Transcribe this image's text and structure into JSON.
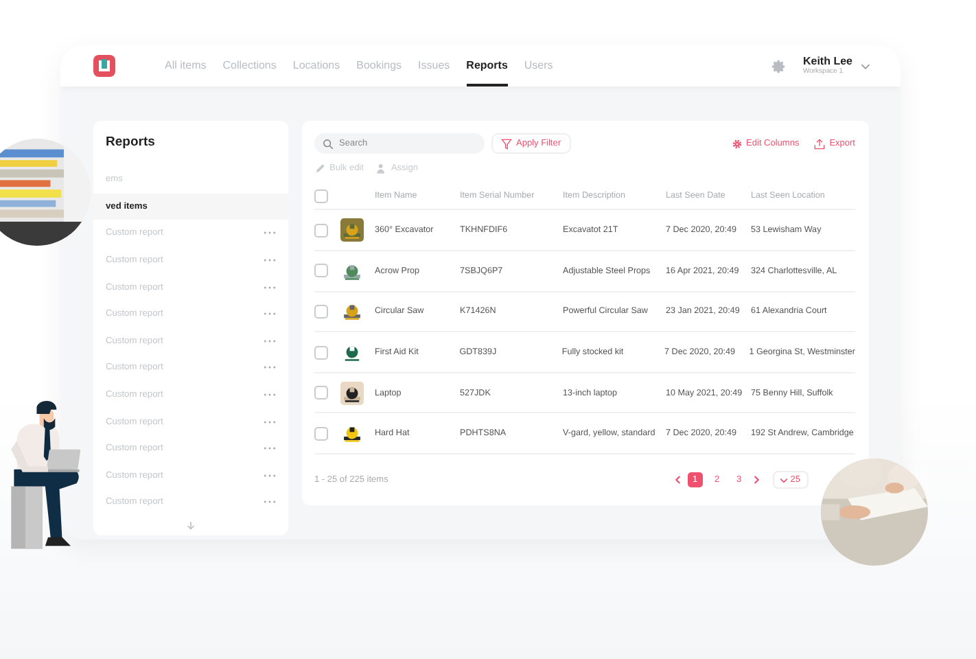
{
  "nav": {
    "tabs": [
      {
        "label": "All items",
        "selected": false
      },
      {
        "label": "Collections",
        "selected": false
      },
      {
        "label": "Locations",
        "selected": false
      },
      {
        "label": "Bookings",
        "selected": false
      },
      {
        "label": "Issues",
        "selected": false
      },
      {
        "label": "Reports",
        "selected": true
      },
      {
        "label": "Users",
        "selected": false
      }
    ],
    "user": {
      "name": "Keith Lee",
      "workspace": "Workspace 1"
    }
  },
  "sidebar": {
    "title": "Reports",
    "items": [
      {
        "label": "ems",
        "selected": false,
        "menu": false
      },
      {
        "label": "ved items",
        "selected": true,
        "menu": false
      },
      {
        "label": "Custom report",
        "selected": false,
        "menu": true
      },
      {
        "label": "Custom report",
        "selected": false,
        "menu": true
      },
      {
        "label": "Custom report",
        "selected": false,
        "menu": true
      },
      {
        "label": "Custom report",
        "selected": false,
        "menu": true
      },
      {
        "label": "Custom report",
        "selected": false,
        "menu": true
      },
      {
        "label": "Custom report",
        "selected": false,
        "menu": true
      },
      {
        "label": "Custom report",
        "selected": false,
        "menu": true
      },
      {
        "label": "Custom report",
        "selected": false,
        "menu": true
      },
      {
        "label": "Custom report",
        "selected": false,
        "menu": true
      },
      {
        "label": "Custom report",
        "selected": false,
        "menu": true
      },
      {
        "label": "Custom report",
        "selected": false,
        "menu": true
      }
    ]
  },
  "toolbar": {
    "search": {
      "placeholder": "Search"
    },
    "filter": "Apply Filter",
    "edit_columns": "Edit Columns",
    "export": "Export",
    "actions": [
      {
        "label": "Bulk edit",
        "kind": "edit",
        "disabled": true
      },
      {
        "label": "Assign",
        "kind": "assign",
        "disabled": true
      }
    ]
  },
  "table": {
    "select_all": {
      "checked": false
    },
    "columns": [
      "Item Name",
      "Item Serial Number",
      "Item Description",
      "Last Seen Date",
      "Last Seen Location"
    ],
    "rows": [
      {
        "checked": false,
        "cells": [
          "360° Excavator",
          "TKHNFDIF6",
          "Excavatot 21T",
          "7 Dec 2020, 20:49",
          "53 Lewisham Way"
        ]
      },
      {
        "checked": false,
        "cells": [
          "Acrow Prop",
          "7SBJQ6P7",
          "Adjustable Steel Props",
          "16 Apr 2021, 20:49",
          "324 Charlottesville, AL"
        ]
      },
      {
        "checked": false,
        "cells": [
          "Circular Saw",
          "K71426N",
          "Powerful Circular Saw",
          "23 Jan 2021, 20:49",
          "61 Alexandria Court"
        ]
      },
      {
        "checked": false,
        "cells": [
          "First Aid Kit",
          "GDT839J",
          "Fully stocked kit",
          "7 Dec 2020, 20:49",
          "1 Georgina St, Westminster"
        ]
      },
      {
        "checked": false,
        "cells": [
          "Laptop",
          "527JDK",
          "13-inch laptop",
          "10 May 2021, 20:49",
          "75 Benny Hill, Suffolk"
        ]
      },
      {
        "checked": false,
        "cells": [
          "Hard Hat",
          "PDHTS8NA",
          "V-gard, yellow, standard",
          "7 Dec 2020, 20:49",
          "192 St Andrew, Cambridge"
        ]
      }
    ]
  },
  "footer": {
    "summary": "1 - 25 of 225 items",
    "pages": [
      {
        "label": "1",
        "selected": true
      },
      {
        "label": "2",
        "selected": false
      },
      {
        "label": "3",
        "selected": false
      }
    ],
    "per_page": "25"
  }
}
